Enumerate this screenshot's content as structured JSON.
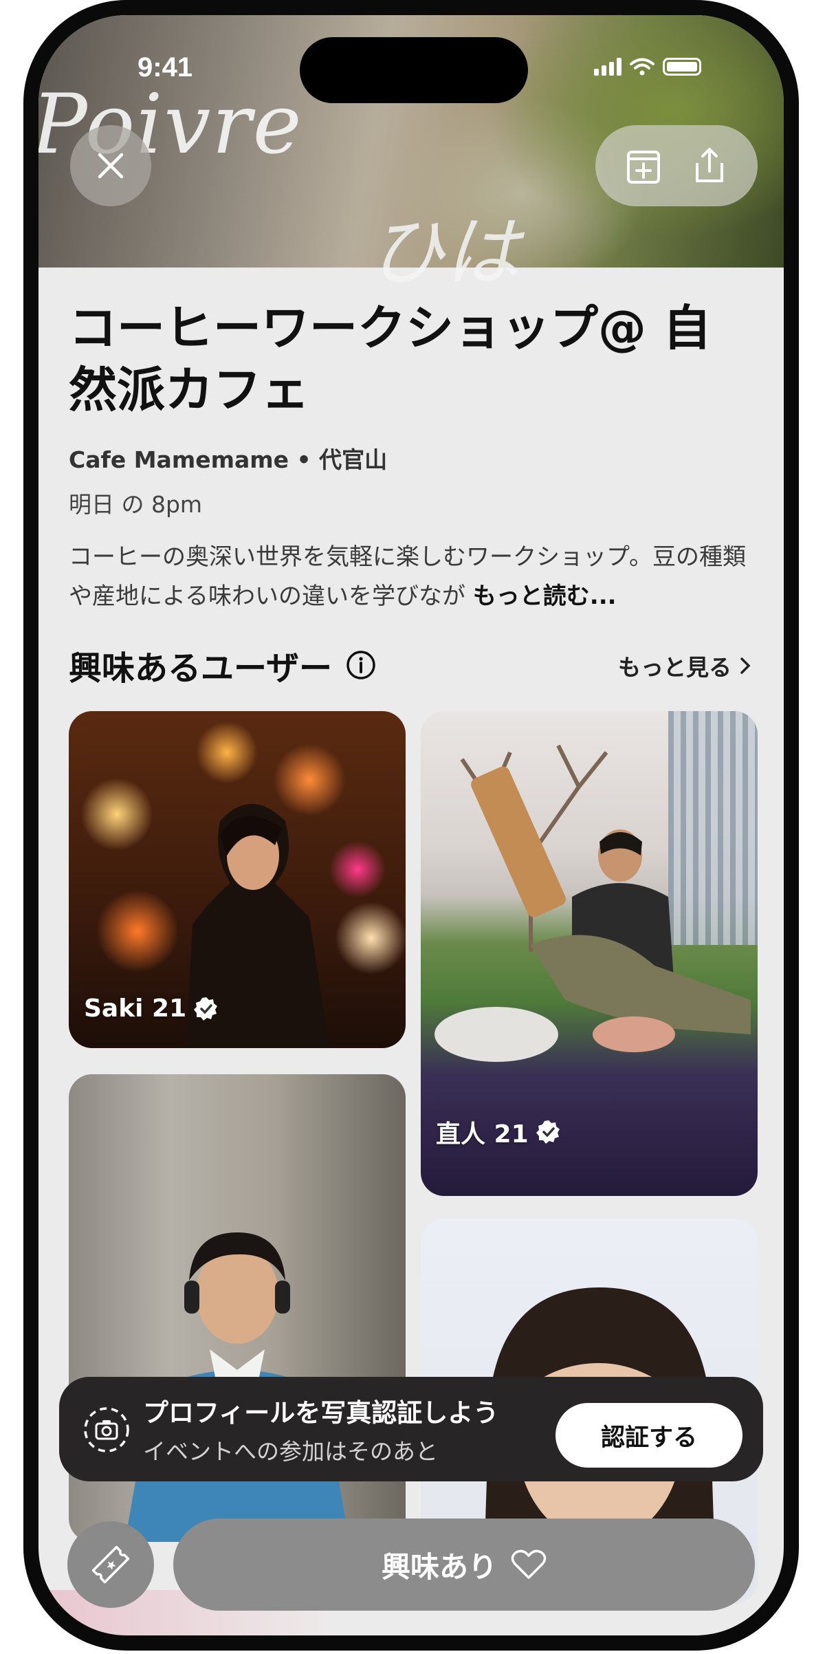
{
  "status_bar": {
    "time": "9:41"
  },
  "hero": {
    "text_top": "Poivre",
    "text_bottom": "ひは"
  },
  "event": {
    "title": "コーヒーワークショップ@ 自然派カフェ",
    "venue": "Cafe Mamemame • 代官山",
    "time": "明日 の 8pm",
    "description": "コーヒーの奥深い世界を気軽に楽しむワークショップ。豆の種類や産地による味わいの違いを学びなが",
    "read_more": "もっと読む..."
  },
  "interested_section": {
    "title": "興味あるユーザー",
    "see_more": "もっと見る",
    "users": [
      {
        "name": "Saki 21"
      },
      {
        "name": "直人 21"
      }
    ]
  },
  "verify_banner": {
    "title": "プロフィールを写真認証しよう",
    "subtitle": "イベントへの参加はそのあと",
    "button": "認証する"
  },
  "bottom_bar": {
    "interest_button": "興味あり"
  },
  "colors": {
    "banner_bg": "#272525",
    "cta_bg": "#8c8c8c",
    "screen_bg": "#ecebeb"
  }
}
